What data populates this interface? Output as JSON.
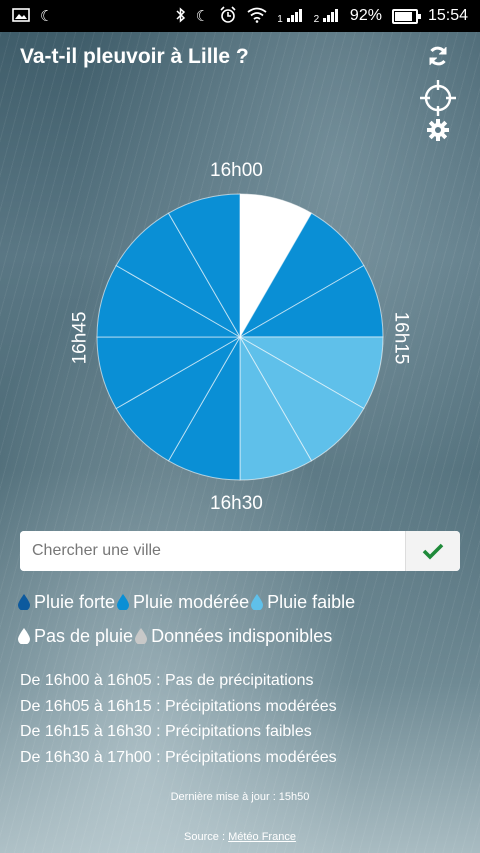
{
  "status_bar": {
    "battery": "92%",
    "time": "15:54",
    "sim1": "1",
    "sim2": "2"
  },
  "header": {
    "title": "Va-t-il pleuvoir à Lille ?"
  },
  "pie": {
    "label_top": "16h00",
    "label_right": "16h15",
    "label_bottom": "16h30",
    "label_left": "16h45"
  },
  "chart_data": {
    "type": "pie",
    "segments": [
      {
        "start": "16h00",
        "end": "16h05",
        "intensity": "Pas de pluie"
      },
      {
        "start": "16h05",
        "end": "16h10",
        "intensity": "Pluie modérée"
      },
      {
        "start": "16h10",
        "end": "16h15",
        "intensity": "Pluie modérée"
      },
      {
        "start": "16h15",
        "end": "16h20",
        "intensity": "Pluie faible"
      },
      {
        "start": "16h20",
        "end": "16h25",
        "intensity": "Pluie faible"
      },
      {
        "start": "16h25",
        "end": "16h30",
        "intensity": "Pluie faible"
      },
      {
        "start": "16h30",
        "end": "16h35",
        "intensity": "Pluie modérée"
      },
      {
        "start": "16h35",
        "end": "16h40",
        "intensity": "Pluie modérée"
      },
      {
        "start": "16h40",
        "end": "16h45",
        "intensity": "Pluie modérée"
      },
      {
        "start": "16h45",
        "end": "16h50",
        "intensity": "Pluie modérée"
      },
      {
        "start": "16h50",
        "end": "16h55",
        "intensity": "Pluie modérée"
      },
      {
        "start": "16h55",
        "end": "17h00",
        "intensity": "Pluie modérée"
      }
    ],
    "colors": {
      "Pluie forte": "#0d5a9e",
      "Pluie modérée": "#0a8fd5",
      "Pluie faible": "#5fc0ea",
      "Pas de pluie": "#ffffff",
      "Données indisponibles": "#c8c8c8"
    }
  },
  "search": {
    "placeholder": "Chercher une ville"
  },
  "legend": [
    {
      "label": "Pluie forte",
      "color": "#0d5a9e"
    },
    {
      "label": "Pluie modérée",
      "color": "#0a8fd5"
    },
    {
      "label": "Pluie faible",
      "color": "#5fc0ea"
    },
    {
      "label": "Pas de pluie",
      "color": "#ffffff"
    },
    {
      "label": "Données indisponibles",
      "color": "#c8c8c8"
    }
  ],
  "details": [
    "De 16h00 à 16h05 : Pas de précipitations",
    "De 16h05 à 16h15 : Précipitations modérées",
    "De 16h15 à 16h30 : Précipitations faibles",
    "De 16h30 à 17h00 : Précipitations modérées"
  ],
  "footer": {
    "updated": "Dernière mise à jour : 15h50",
    "source_prefix": "Source : ",
    "source_link": "Météo France"
  }
}
